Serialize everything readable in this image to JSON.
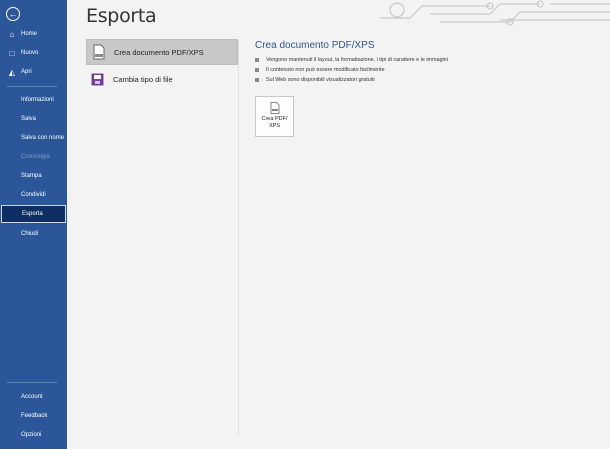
{
  "sidebar": {
    "back_icon": "arrow-left-icon",
    "top_items": [
      {
        "label": "Home",
        "icon": "home-icon"
      },
      {
        "label": "Nuovo",
        "icon": "new-document-icon"
      },
      {
        "label": "Apri",
        "icon": "folder-icon"
      }
    ],
    "items": [
      {
        "label": "Informazioni",
        "state": "normal"
      },
      {
        "label": "Salva",
        "state": "normal"
      },
      {
        "label": "Salva con nome",
        "state": "normal"
      },
      {
        "label": "Cronologia",
        "state": "disabled"
      },
      {
        "label": "Stampa",
        "state": "normal"
      },
      {
        "label": "Condividi",
        "state": "normal"
      },
      {
        "label": "Esporta",
        "state": "selected"
      },
      {
        "label": "Chiudi",
        "state": "normal"
      }
    ],
    "bottom_items": [
      {
        "label": "Account"
      },
      {
        "label": "Feedback"
      },
      {
        "label": "Opzioni"
      }
    ]
  },
  "page": {
    "title": "Esporta"
  },
  "export_options": [
    {
      "label": "Crea documento PDF/XPS",
      "icon": "pdf-document-icon",
      "selected": true
    },
    {
      "label": "Cambia tipo di file",
      "icon": "change-file-type-icon",
      "selected": false
    }
  ],
  "detail": {
    "title": "Crea documento PDF/XPS",
    "bullets": [
      "Vengono mantenuti il layout, la formattazione, i tipi di carattere e le immagini",
      "Il contenuto non può essere modificato facilmente",
      "Sul Web sono disponibili visualizzatori gratuiti"
    ],
    "button_label": "Crea PDF/ XPS"
  },
  "colors": {
    "sidebar": "#2b579a",
    "selected_nav": "#0e2f63",
    "accent_title": "#2b579a"
  }
}
